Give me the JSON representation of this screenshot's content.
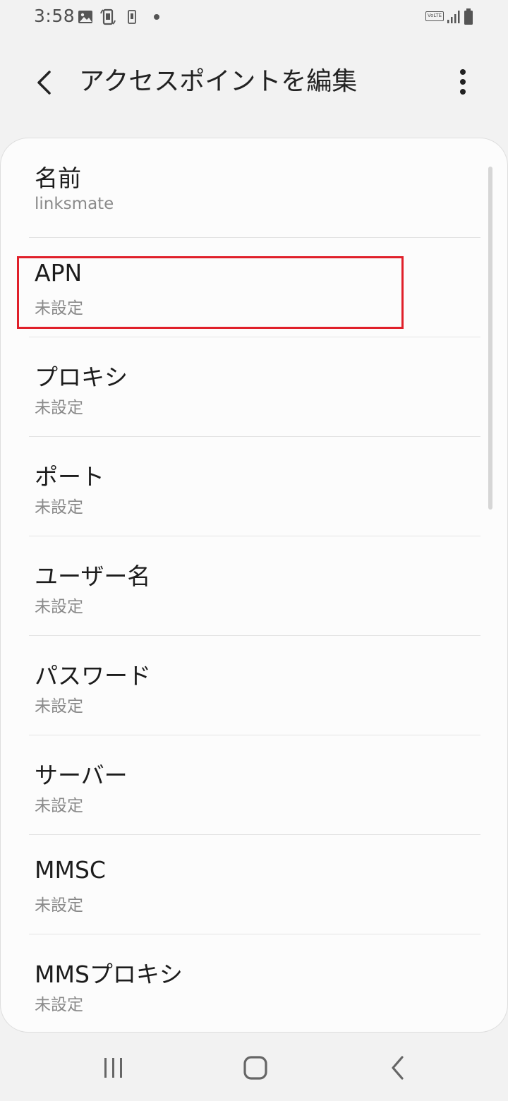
{
  "status_bar": {
    "time": "3:58",
    "icons": [
      "gallery-icon",
      "screen-rotate-icon",
      "phone-icon",
      "dot-icon",
      "volte-icon",
      "signal-icon",
      "battery-icon"
    ],
    "volte_label": "VoLTE"
  },
  "app_bar": {
    "title": "アクセスポイントを編集"
  },
  "settings": [
    {
      "title": "名前",
      "value": "linksmate"
    },
    {
      "title": "APN",
      "value": "未設定"
    },
    {
      "title": "プロキシ",
      "value": "未設定"
    },
    {
      "title": "ポート",
      "value": "未設定"
    },
    {
      "title": "ユーザー名",
      "value": "未設定"
    },
    {
      "title": "パスワード",
      "value": "未設定"
    },
    {
      "title": "サーバー",
      "value": "未設定"
    },
    {
      "title": "MMSC",
      "value": "未設定"
    },
    {
      "title": "MMSプロキシ",
      "value": "未設定"
    }
  ],
  "highlight_color": "#e0202a",
  "nav_bar": {
    "icons": [
      "recents-icon",
      "home-icon",
      "back-icon"
    ]
  }
}
